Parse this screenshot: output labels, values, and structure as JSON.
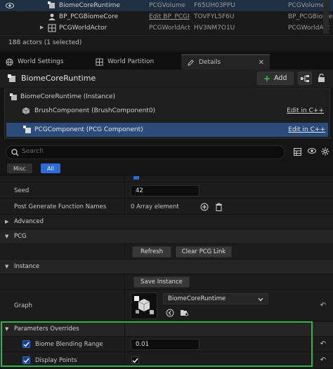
{
  "outliner": {
    "rows": [
      {
        "name": "BiomeCoreRuntime",
        "type": "PCGVolume",
        "label": "F65UH03PPU",
        "last": "PCGVolume_",
        "selected": true
      },
      {
        "name": "BP_PCGBiomeCore",
        "type": "Edit BP_PCGI",
        "label": "TOVFYL5F6U",
        "last": "BP_PCGBiome",
        "selected": false
      },
      {
        "name": "PCGWorldActor",
        "type": "PCGWorldAct",
        "label": "HV3NM7O1U",
        "last": "PCGWorldAct",
        "selected": false
      }
    ],
    "status": "188 actors (1 selected)"
  },
  "tabs": [
    {
      "label": "World Settings",
      "icon": "globe-icon"
    },
    {
      "label": "World Partition",
      "icon": "grid-icon"
    },
    {
      "label": "Details",
      "icon": "pencil-icon",
      "close": "✕"
    }
  ],
  "details": {
    "actor_name": "BiomeCoreRuntime",
    "add_label": "Add",
    "components": {
      "instance": "BiomeCoreRuntime (Instance)",
      "items": [
        {
          "label": "BrushComponent (BrushComponent0)",
          "edit": "Edit in C++"
        },
        {
          "label": "PCGComponent (PCG Component)",
          "edit": "Edit in C++"
        }
      ]
    },
    "search_placeholder": "Search",
    "filters": {
      "misc": "Misc",
      "all": "All"
    }
  },
  "properties": {
    "seed_label": "Seed",
    "seed_value": "42",
    "post_gen_label": "Post Generate Function Names",
    "post_gen_value": "0 Array element",
    "advanced": "Advanced",
    "pcg_cat": "PCG",
    "refresh": "Refresh",
    "clear_link": "Clear PCG Link",
    "instance_cat": "Instance",
    "save_instance": "Save Instance",
    "graph_label": "Graph",
    "graph_value": "BiomeCoreRuntime",
    "param_overrides": "Parameters Overrides",
    "biome_blending_label": "Biome Blending Range",
    "biome_blending_value": "0.01",
    "display_points_label": "Display Points"
  },
  "colors": {
    "accent": "#2e6bd6",
    "highlight_border": "#2fb44a",
    "add_button_green": "#3fbf4a"
  }
}
